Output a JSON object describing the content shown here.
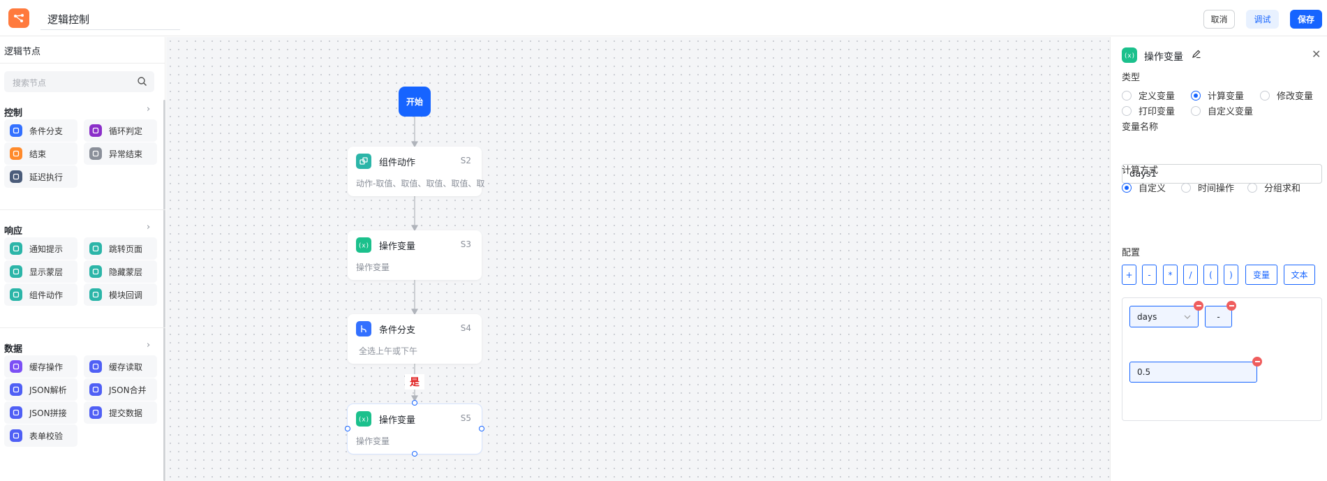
{
  "header": {
    "title": "逻辑控制",
    "cancel_label": "取消",
    "debug_label": "调试",
    "save_label": "保存"
  },
  "sidebar": {
    "title": "逻辑节点",
    "search_placeholder": "搜索节点",
    "groups": [
      {
        "title": "控制",
        "items": [
          {
            "label": "条件分支",
            "icon": "branch-icon",
            "color": "#3370ff"
          },
          {
            "label": "循环判定",
            "icon": "loop-icon",
            "color": "#8b2fc9"
          },
          {
            "label": "结束",
            "icon": "end-icon",
            "color": "#ff8a2b"
          },
          {
            "label": "异常结束",
            "icon": "abnormal-end-icon",
            "color": "#8a8f99"
          },
          {
            "label": "延迟执行",
            "icon": "delay-icon",
            "color": "#4b5c7a"
          }
        ]
      },
      {
        "title": "响应",
        "items": [
          {
            "label": "通知提示",
            "icon": "bell-icon",
            "color": "#2bb5a8"
          },
          {
            "label": "跳转页面",
            "icon": "jump-icon",
            "color": "#2bb5a8"
          },
          {
            "label": "显示蒙层",
            "icon": "show-mask-icon",
            "color": "#2bb5a8"
          },
          {
            "label": "隐藏蒙层",
            "icon": "hide-mask-icon",
            "color": "#2bb5a8"
          },
          {
            "label": "组件动作",
            "icon": "component-action-icon",
            "color": "#2bb5a8"
          },
          {
            "label": "模块回调",
            "icon": "module-callback-icon",
            "color": "#2bb5a8"
          }
        ]
      },
      {
        "title": "数据",
        "items": [
          {
            "label": "缓存操作",
            "icon": "cache-op-icon",
            "color": "#7b4ff5"
          },
          {
            "label": "缓存读取",
            "icon": "cache-read-icon",
            "color": "#4f5ff5"
          },
          {
            "label": "JSON解析",
            "icon": "json-parse-icon",
            "color": "#4f5ff5"
          },
          {
            "label": "JSON合并",
            "icon": "json-merge-icon",
            "color": "#4f5ff5"
          },
          {
            "label": "JSON拼接",
            "icon": "json-concat-icon",
            "color": "#4f5ff5"
          },
          {
            "label": "提交数据",
            "icon": "submit-data-icon",
            "color": "#4f5ff5"
          },
          {
            "label": "表单校验",
            "icon": "form-validate-icon",
            "color": "#4f5ff5"
          }
        ]
      }
    ]
  },
  "canvas": {
    "start_label": "开始",
    "nodes": [
      {
        "title": "组件动作",
        "step": "S2",
        "desc": "动作-取值、取值、取值、取值、取",
        "icon": "component-action-icon",
        "color": "#2bb5a8"
      },
      {
        "title": "操作变量",
        "step": "S3",
        "desc": "操作变量",
        "icon": "variable-icon",
        "color": "#1bc08c"
      },
      {
        "title": "条件分支",
        "step": "S4",
        "desc": "全选上午或下午",
        "icon": "branch-icon",
        "color": "#3370ff"
      },
      {
        "title": "操作变量",
        "step": "S5",
        "desc": "操作变量",
        "icon": "variable-icon",
        "color": "#1bc08c"
      }
    ],
    "edge_label": "是"
  },
  "panel": {
    "title": "操作变量",
    "type_label": "类型",
    "type_options": [
      "定义变量",
      "计算变量",
      "修改变量",
      "打印变量",
      "自定义变量"
    ],
    "type_selected": "计算变量",
    "name_label": "变量名称",
    "name_value": "days1",
    "method_label": "计算方式",
    "method_options": [
      "自定义",
      "时间操作",
      "分组求和"
    ],
    "method_selected": "自定义",
    "config_label": "配置",
    "operators": [
      "+",
      "-",
      "*",
      "/",
      "(",
      ")",
      "变量",
      "文本"
    ],
    "expression": {
      "variable": "days",
      "operator": "-",
      "constant": "0.5"
    },
    "accent_color": "#1664ff"
  }
}
